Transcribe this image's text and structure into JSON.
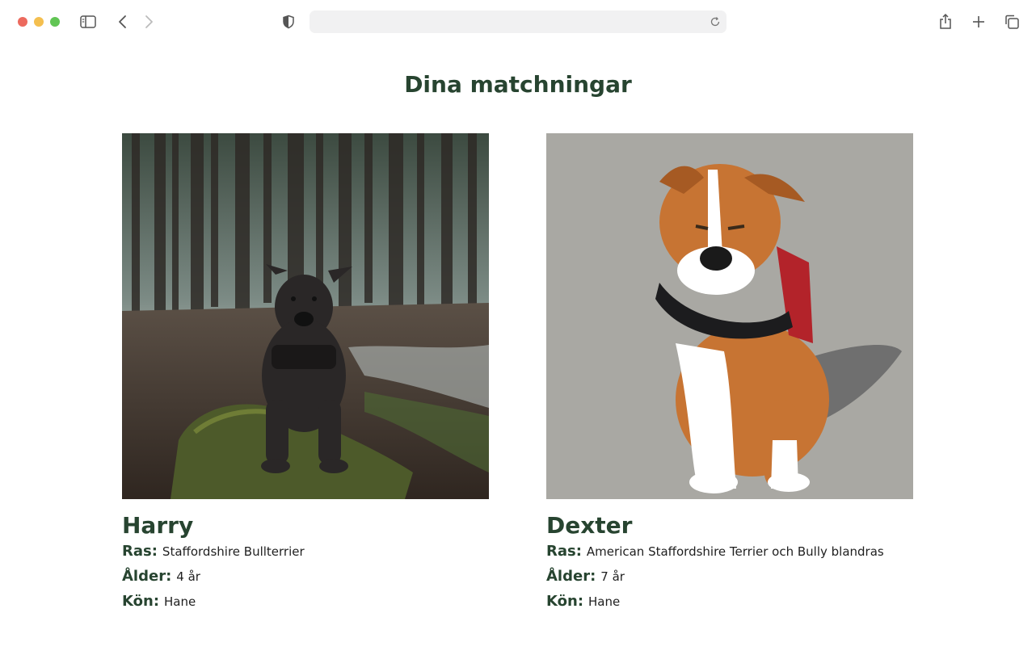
{
  "browser": {
    "icons": [
      "sidebar-icon",
      "chevron-left-icon",
      "chevron-right-icon",
      "shield-icon",
      "reload-icon",
      "share-icon",
      "plus-icon",
      "tabs-icon"
    ],
    "address": ""
  },
  "page": {
    "title": "Dina matchningar"
  },
  "matches": [
    {
      "name": "Harry",
      "breed_label": "Ras:",
      "breed": "Staffordshire Bullterrier",
      "age_label": "Ålder:",
      "age": "4 år",
      "sex_label": "Kön:",
      "sex": "Hane"
    },
    {
      "name": "Dexter",
      "breed_label": "Ras:",
      "breed": "American Staffordshire Terrier och Bully blandras",
      "age_label": "Ålder:",
      "age": "7 år",
      "sex_label": "Kön:",
      "sex": "Hane"
    }
  ],
  "colors": {
    "accent": "#274430",
    "text": "#1f1f1f"
  }
}
